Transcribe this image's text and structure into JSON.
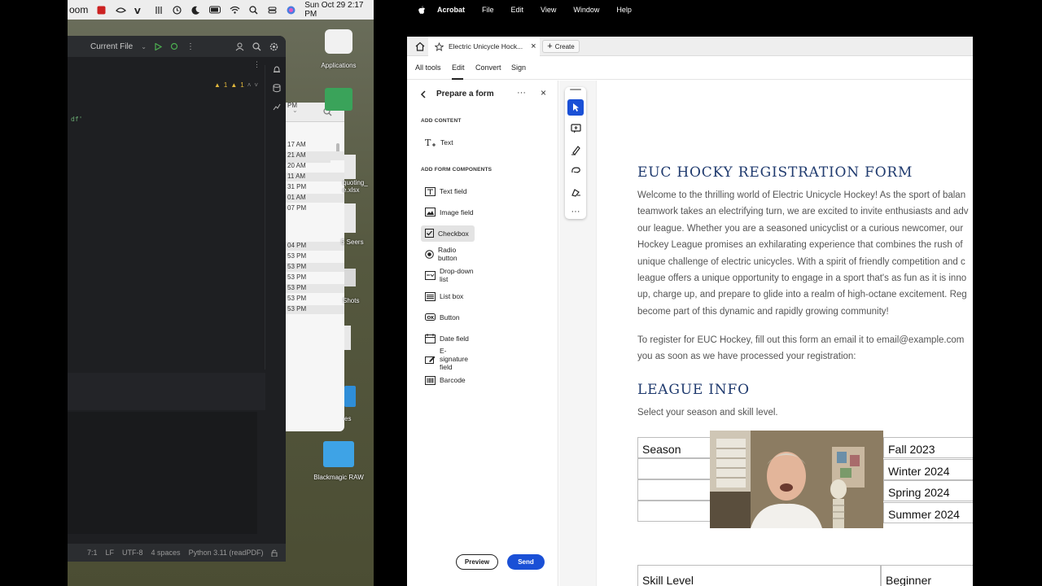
{
  "left_menubar": {
    "app_fragment": "oom",
    "clock": "Sun Oct 29  2:17 PM"
  },
  "ide": {
    "run_config": "Current File",
    "warnings": "1",
    "weak_warnings": "1",
    "code_fragment": "df'",
    "status": {
      "position": "7:1",
      "line_sep": "LF",
      "encoding": "UTF-8",
      "indent": "4 spaces",
      "interpreter": "Python 3.11 (readPDF)"
    }
  },
  "finder_rows": [
    "PM",
    "PM",
    "17 AM",
    "21 AM",
    "20 AM",
    "11 AM",
    "31 PM",
    "01 AM",
    "07 PM",
    "04 PM",
    "53 PM",
    "53 PM",
    "53 PM",
    "53 PM",
    "53 PM",
    "53 PM"
  ],
  "desktop_icons": {
    "applications": "Applications",
    "quoting_line1": "quoting_",
    "quoting_line2": "e.xlsx",
    "seers": "5 Seers",
    "shots": "Shots",
    "es": "es",
    "blackmagic": "Blackmagic RAW"
  },
  "mac_menubar": {
    "app": "Acrobat",
    "items": [
      "File",
      "Edit",
      "View",
      "Window",
      "Help"
    ]
  },
  "acrobat": {
    "tab_title": "Electric Unicycle Hock...",
    "create": "Create",
    "nav": {
      "all_tools": "All tools",
      "edit": "Edit",
      "convert": "Convert",
      "sign": "Sign"
    },
    "panel": {
      "title": "Prepare a form",
      "add_content": "ADD CONTENT",
      "text": "Text",
      "add_form_components": "ADD FORM COMPONENTS",
      "components": [
        "Text field",
        "Image field",
        "Checkbox",
        "Radio button",
        "Drop-down list",
        "List box",
        "Button",
        "Date field",
        "E-signature field",
        "Barcode"
      ],
      "selected": "Checkbox",
      "preview": "Preview",
      "send": "Send"
    },
    "document": {
      "title": "EUC HOCKY REGISTRATION FORM",
      "intro_lines": [
        "Welcome to the thrilling world of Electric Unicycle Hockey! As the sport of balan",
        "teamwork takes an electrifying turn, we are excited to invite enthusiasts and adv",
        "our league. Whether you are a seasoned unicyclist or a curious newcomer, our",
        "Hockey League promises an exhilarating experience that combines the rush of",
        "unique challenge of electric unicycles. With a spirit of friendly competition and c",
        "league offers a unique opportunity to engage in a sport that's as fun as it is inno",
        "up, charge up, and prepare to glide into a realm of high-octane excitement. Reg",
        "become part of this dynamic and rapidly growing community!"
      ],
      "register_lines": [
        "To register for EUC Hockey, fill out this form an email it to email@example.com",
        "you as soon as we have processed your registration:"
      ],
      "league_heading": "LEAGUE INFO",
      "league_sub": "Select your season and skill level.",
      "season_label": "Season",
      "seasons": [
        "Fall 2023",
        "Winter 2024",
        "Spring 2024",
        "Summer 2024"
      ],
      "skill_label": "Skill Level",
      "skill_first": "Beginner"
    }
  }
}
